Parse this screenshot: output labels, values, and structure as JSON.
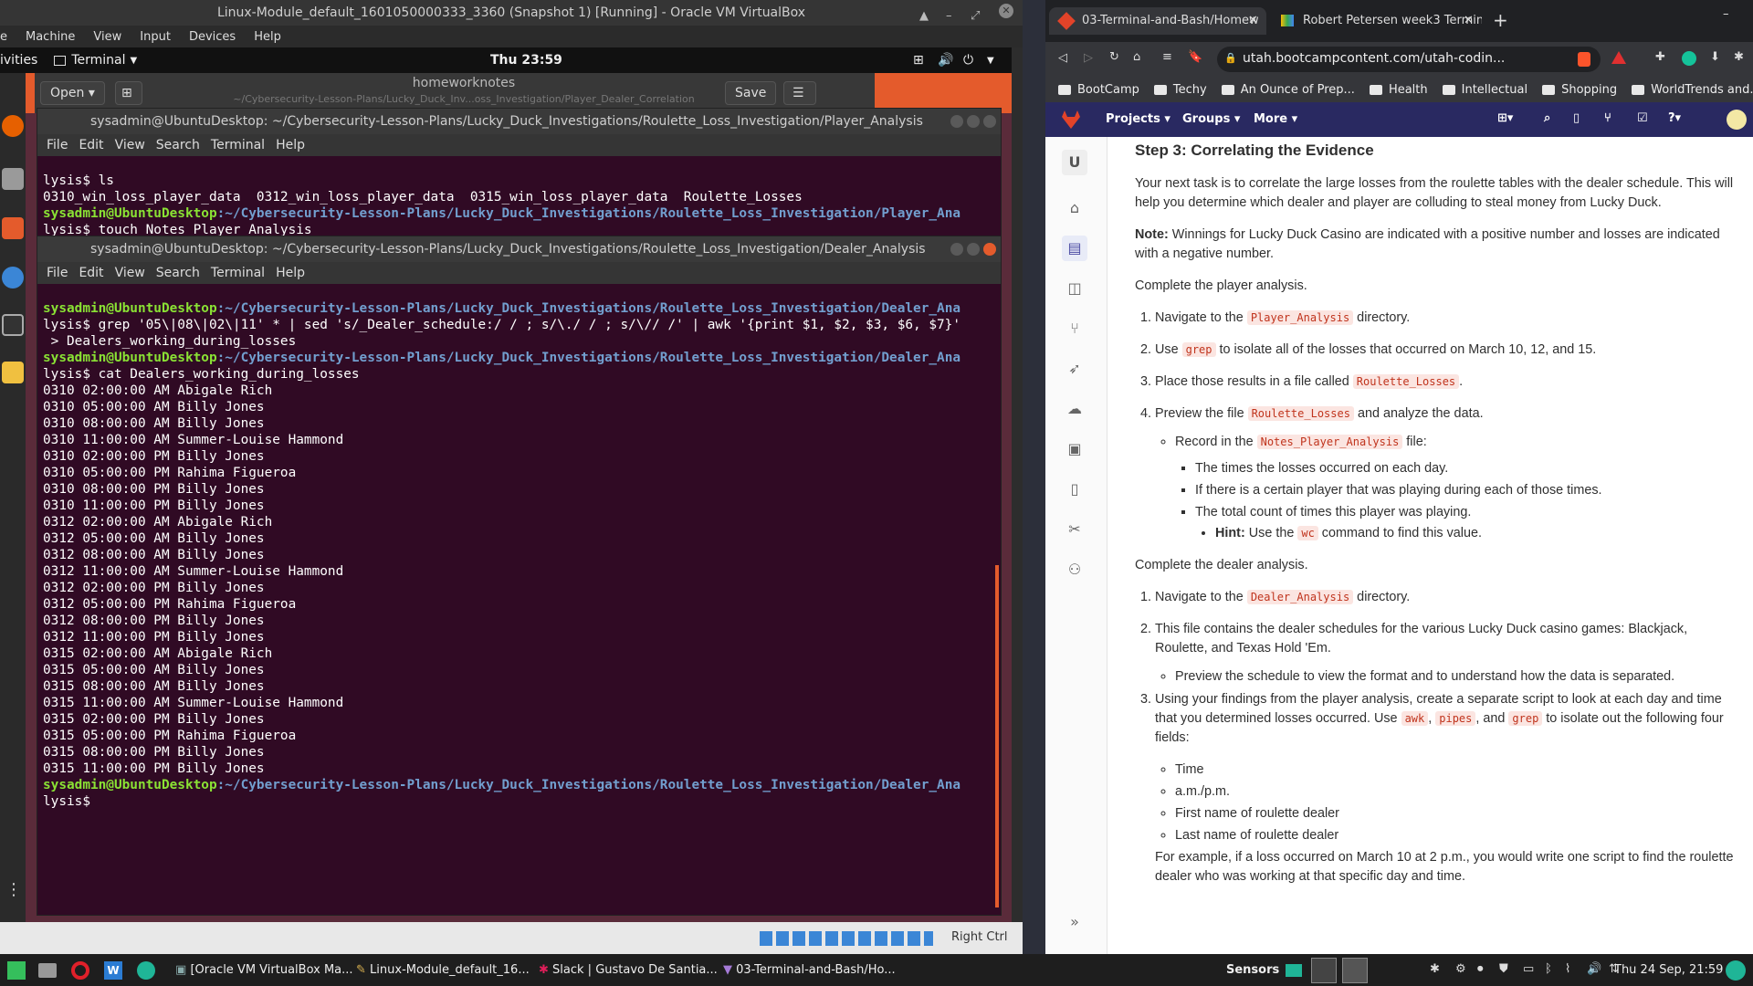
{
  "vbox": {
    "title": "Linux-Module_default_1601050000333_3360 (Snapshot 1) [Running] - Oracle VM VirtualBox",
    "menu": [
      "Machine",
      "View",
      "Input",
      "Devices",
      "Help"
    ],
    "status_right": "Right Ctrl"
  },
  "gnome": {
    "activities": "ivities",
    "app": "Terminal",
    "clock": "Thu 23:59"
  },
  "gedit": {
    "open": "Open",
    "title": "homeworknotes",
    "subtitle": "~/Cybersecurity-Lesson-Plans/Lucky_Duck_Inv...oss_Investigation/Player_Dealer_Correlation",
    "save": "Save"
  },
  "term1": {
    "title": "sysadmin@UbuntuDesktop: ~/Cybersecurity-Lesson-Plans/Lucky_Duck_Investigations/Roulette_Loss_Investigation/Player_Analysis",
    "menu": [
      "File",
      "Edit",
      "View",
      "Search",
      "Terminal",
      "Help"
    ],
    "lines": [
      "lysis$ ls",
      "0310_win_loss_player_data  0312_win_loss_player_data  0315_win_loss_player_data  Roulette_Losses"
    ],
    "prompt_user": "sysadmin@UbuntuDesktop",
    "prompt_path": ":~/Cybersecurity-Lesson-Plans/Lucky_Duck_Investigations/Roulette_Loss_Investigation/Player_Ana",
    "cmd2": "lysis$ touch Notes_Player_Analysis"
  },
  "term2": {
    "title": "sysadmin@UbuntuDesktop: ~/Cybersecurity-Lesson-Plans/Lucky_Duck_Investigations/Roulette_Loss_Investigation/Dealer_Analysis",
    "menu": [
      "File",
      "Edit",
      "View",
      "Search",
      "Terminal",
      "Help"
    ],
    "prompt_user": "sysadmin@UbuntuDesktop",
    "prompt_path": ":~/Cybersecurity-Lesson-Plans/Lucky_Duck_Investigations/Roulette_Loss_Investigation/Dealer_Ana",
    "cmd1a": "lysis$ grep '05\\|08\\|02\\|11' * | sed 's/_Dealer_schedule:/ / ; s/\\./ / ; s/\\// /' | awk '{print $1, $2, $3, $6, $7}'",
    "cmd1b": " > Dealers_working_during_losses",
    "cmd2": "lysis$ cat Dealers_working_during_losses",
    "output": [
      "0310 02:00:00 AM Abigale Rich",
      "0310 05:00:00 AM Billy Jones",
      "0310 08:00:00 AM Billy Jones",
      "0310 11:00:00 AM Summer-Louise Hammond",
      "0310 02:00:00 PM Billy Jones",
      "0310 05:00:00 PM Rahima Figueroa",
      "0310 08:00:00 PM Billy Jones",
      "0310 11:00:00 PM Billy Jones",
      "0312 02:00:00 AM Abigale Rich",
      "0312 05:00:00 AM Billy Jones",
      "0312 08:00:00 AM Billy Jones",
      "0312 11:00:00 AM Summer-Louise Hammond",
      "0312 02:00:00 PM Billy Jones",
      "0312 05:00:00 PM Rahima Figueroa",
      "0312 08:00:00 PM Billy Jones",
      "0312 11:00:00 PM Billy Jones",
      "0315 02:00:00 AM Abigale Rich",
      "0315 05:00:00 AM Billy Jones",
      "0315 08:00:00 AM Billy Jones",
      "0315 11:00:00 AM Summer-Louise Hammond",
      "0315 02:00:00 PM Billy Jones",
      "0315 05:00:00 PM Rahima Figueroa",
      "0315 08:00:00 PM Billy Jones",
      "0315 11:00:00 PM Billy Jones"
    ],
    "final_prompt": "lysis$"
  },
  "browser": {
    "tab1": "03-Terminal-and-Bash/Homew",
    "tab2": "Robert Petersen week3 Termin",
    "url": "utah.bootcampcontent.com/utah-codin...",
    "bookmarks": [
      "BootCamp",
      "Techy",
      "An Ounce of Prep...",
      "Health",
      "Intellectual",
      "Shopping",
      "WorldTrends and..."
    ],
    "nav": [
      "Projects",
      "Groups",
      "More"
    ],
    "side_letter": "U"
  },
  "doc": {
    "heading": "Step 3: Correlating the Evidence",
    "intro": "Your next task is to correlate the large losses from the roulette tables with the dealer schedule. This will help you determine which dealer and player are colluding to steal money from Lucky Duck.",
    "note_label": "Note:",
    "note_text": " Winnings for Lucky Duck Casino are indicated with a positive number and losses are indicated with a negative number.",
    "player_intro": "Complete the player analysis.",
    "p1a": "Navigate to the ",
    "p1code": "Player_Analysis",
    "p1b": " directory.",
    "p2a": "Use ",
    "p2code": "grep",
    "p2b": " to isolate all of the losses that occurred on March 10, 12, and 15.",
    "p3a": "Place those results in a file called ",
    "p3code": "Roulette_Losses",
    "p3b": ".",
    "p4a": "Preview the file ",
    "p4code": "Roulette_Losses",
    "p4b": " and analyze the data.",
    "rec_a": "Record in the ",
    "rec_code": "Notes_Player_Analysis",
    "rec_b": " file:",
    "rec1": "The times the losses occurred on each day.",
    "rec2": "If there is a certain player that was playing during each of those times.",
    "rec3": "The total count of times this player was playing.",
    "hint_label": "Hint:",
    "hint_a": " Use the ",
    "hint_code": "wc",
    "hint_b": " command to find this value.",
    "dealer_intro": "Complete the dealer analysis.",
    "d1a": "Navigate to the ",
    "d1code": "Dealer_Analysis",
    "d1b": " directory.",
    "d2": "This file contains the dealer schedules for the various Lucky Duck casino games: Blackjack, Roulette, and Texas Hold 'Em.",
    "d2sub": "Preview the schedule to view the format and to understand how the data is separated.",
    "d3a": "Using your findings from the player analysis, create a separate script to look at each day and time that you determined losses occurred. Use ",
    "d3code1": "awk",
    "d3sep1": ", ",
    "d3code2": "pipes",
    "d3sep2": ", and ",
    "d3code3": "grep",
    "d3b": " to isolate out the following four fields:",
    "fields": [
      "Time",
      "a.m./p.m.",
      "First name of roulette dealer",
      "Last name of roulette dealer"
    ],
    "example": "For example, if a loss occurred on March 10 at 2 p.m., you would write one script to find the roulette dealer who was working at that specific day and time."
  },
  "taskbar": {
    "items": [
      "[Oracle VM VirtualBox Ma...",
      "Linux-Module_default_16...",
      "Slack | Gustavo De Santia...",
      "03-Terminal-and-Bash/Ho..."
    ],
    "sensors": "Sensors",
    "clock": "Thu 24 Sep, 21:59"
  },
  "colors": {
    "accent_orange": "#e45b2c",
    "terminal_bg": "#300a24",
    "gitlab_nav": "#292961"
  }
}
